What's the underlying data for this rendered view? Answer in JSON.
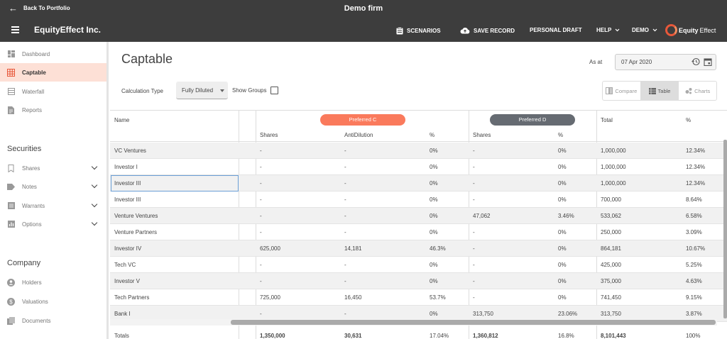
{
  "topbar": {
    "back_label": "Back To Portfolio",
    "firm_title": "Demo firm"
  },
  "nav": {
    "brand": "EquityEffect Inc.",
    "scenarios": "SCENARIOS",
    "save_record": "SAVE RECORD",
    "personal_draft": "PERSONAL DRAFT",
    "help": "HELP",
    "demo": "DEMO",
    "logo_strong": "Equity",
    "logo_thin": "Effect"
  },
  "sidebar": {
    "items": [
      {
        "label": "Dashboard",
        "icon": "dashboard-icon"
      },
      {
        "label": "Captable",
        "icon": "grid-icon",
        "active": true
      },
      {
        "label": "Waterfall",
        "icon": "waterfall-icon"
      },
      {
        "label": "Reports",
        "icon": "report-icon"
      }
    ],
    "securities_heading": "Securities",
    "securities": [
      {
        "label": "Shares",
        "icon": "bookmark-icon"
      },
      {
        "label": "Notes",
        "icon": "tag-icon"
      },
      {
        "label": "Warrants",
        "icon": "list-icon"
      },
      {
        "label": "Options",
        "icon": "chart-icon"
      }
    ],
    "company_heading": "Company",
    "company": [
      {
        "label": "Holders",
        "icon": "person-icon"
      },
      {
        "label": "Valuations",
        "icon": "dollar-icon"
      },
      {
        "label": "Documents",
        "icon": "documents-icon"
      }
    ]
  },
  "page": {
    "title": "Captable",
    "as_at_label": "As at",
    "as_at_date": "07 Apr 2020",
    "calc_type_label": "Calculation Type",
    "calc_type_value": "Fully Diluted",
    "show_groups_label": "Show Groups",
    "view_compare": "Compare",
    "view_table": "Table",
    "view_charts": "Charts"
  },
  "colors": {
    "preferred_c": "#fa7a5c",
    "preferred_d": "#666b72",
    "accent": "#e8583a"
  },
  "table": {
    "name_header": "Name",
    "group_c": "Preferred C",
    "group_d": "Preferred D",
    "total_header": "Total",
    "pct_header": "%",
    "sub_shares_c": "Shares",
    "sub_antidilution": "AntiDilution",
    "sub_pct_c": "%",
    "sub_shares_d": "Shares",
    "sub_pct_d": "%",
    "rows": [
      {
        "name": "VC Ventures",
        "c_shares": "-",
        "c_anti": "-",
        "c_pct": "0%",
        "d_shares": "-",
        "d_pct": "0%",
        "total": "1,000,000",
        "pct": "12.34%"
      },
      {
        "name": "Investor I",
        "c_shares": "-",
        "c_anti": "-",
        "c_pct": "0%",
        "d_shares": "-",
        "d_pct": "0%",
        "total": "1,000,000",
        "pct": "12.34%"
      },
      {
        "name": "Investor III",
        "c_shares": "-",
        "c_anti": "-",
        "c_pct": "0%",
        "d_shares": "-",
        "d_pct": "0%",
        "total": "1,000,000",
        "pct": "12.34%"
      },
      {
        "name": "Investor III",
        "c_shares": "-",
        "c_anti": "-",
        "c_pct": "0%",
        "d_shares": "-",
        "d_pct": "0%",
        "total": "700,000",
        "pct": "8.64%"
      },
      {
        "name": "Venture Ventures",
        "c_shares": "-",
        "c_anti": "-",
        "c_pct": "0%",
        "d_shares": "47,062",
        "d_pct": "3.46%",
        "total": "533,062",
        "pct": "6.58%"
      },
      {
        "name": "Venture Partners",
        "c_shares": "-",
        "c_anti": "-",
        "c_pct": "0%",
        "d_shares": "-",
        "d_pct": "0%",
        "total": "250,000",
        "pct": "3.09%"
      },
      {
        "name": "Investor IV",
        "c_shares": "625,000",
        "c_anti": "14,181",
        "c_pct": "46.3%",
        "d_shares": "-",
        "d_pct": "0%",
        "total": "864,181",
        "pct": "10.67%"
      },
      {
        "name": "Tech VC",
        "c_shares": "-",
        "c_anti": "-",
        "c_pct": "0%",
        "d_shares": "-",
        "d_pct": "0%",
        "total": "425,000",
        "pct": "5.25%"
      },
      {
        "name": "Investor V",
        "c_shares": "-",
        "c_anti": "-",
        "c_pct": "0%",
        "d_shares": "-",
        "d_pct": "0%",
        "total": "375,000",
        "pct": "4.63%"
      },
      {
        "name": "Tech Partners",
        "c_shares": "725,000",
        "c_anti": "16,450",
        "c_pct": "53.7%",
        "d_shares": "-",
        "d_pct": "0%",
        "total": "741,450",
        "pct": "9.15%"
      },
      {
        "name": "Bank I",
        "c_shares": "-",
        "c_anti": "-",
        "c_pct": "0%",
        "d_shares": "313,750",
        "d_pct": "23.06%",
        "total": "313,750",
        "pct": "3.87%"
      }
    ],
    "totals": {
      "name": "Totals",
      "c_shares": "1,350,000",
      "c_anti": "30,631",
      "c_pct": "17.04%",
      "d_shares": "1,360,812",
      "d_pct": "16.8%",
      "total": "8,101,443",
      "pct": "100%"
    }
  }
}
